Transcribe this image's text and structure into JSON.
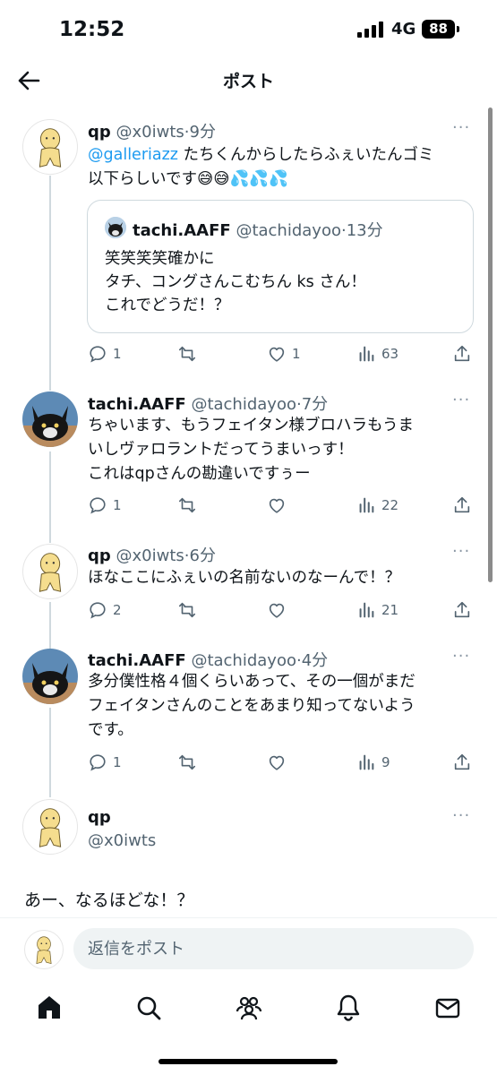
{
  "status_bar": {
    "time": "12:52",
    "network": "4G",
    "battery": "88"
  },
  "header": {
    "title": "ポスト"
  },
  "posts": [
    {
      "display_name": "qp",
      "handle": "@x0iwts",
      "time": "9分",
      "mention": "@galleriazz",
      "text_line1": " たちくんからしたらふぇいたんゴミ",
      "text_line2": "以下らしいです😅😅💦💦💦",
      "quote": {
        "display_name": "tachi.AAFF",
        "handle": "@tachidayoo",
        "time": "13分",
        "lines": [
          "笑笑笑笑確かに",
          "タチ、コングさんこむちん ks さん！",
          "これでどうだ！？"
        ]
      },
      "replies": "1",
      "reposts": "",
      "likes": "1",
      "views": "63"
    },
    {
      "display_name": "tachi.AAFF",
      "handle": "@tachidayoo",
      "time": "7分",
      "lines": [
        "ちゃいます、もうフェイタン様ブロハラもうま",
        "いしヴァロラントだってうまいっす！",
        "これはqpさんの勘違いですぅー"
      ],
      "replies": "1",
      "reposts": "",
      "likes": "",
      "views": "22"
    },
    {
      "display_name": "qp",
      "handle": "@x0iwts",
      "time": "6分",
      "lines": [
        "ほなここにふぇいの名前ないのなーんで！？"
      ],
      "replies": "2",
      "reposts": "",
      "likes": "",
      "views": "21"
    },
    {
      "display_name": "tachi.AAFF",
      "handle": "@tachidayoo",
      "time": "4分",
      "lines": [
        "多分僕性格４個くらいあって、その一個がまだ",
        "フェイタンさんのことをあまり知ってないよう",
        "です。"
      ],
      "replies": "1",
      "reposts": "",
      "likes": "",
      "views": "9"
    }
  ],
  "main_post": {
    "display_name": "qp",
    "handle": "@x0iwts",
    "text": "あー、なるほどな！？"
  },
  "reply_box": {
    "placeholder": "返信をポスト"
  },
  "more_glyph": "···",
  "tabs": [
    "home-icon",
    "search-icon",
    "communities-icon",
    "notifications-icon",
    "messages-icon"
  ],
  "colors": {
    "accent": "#1d9bf0",
    "secondary_text": "#536471",
    "border": "#cfd9de"
  }
}
